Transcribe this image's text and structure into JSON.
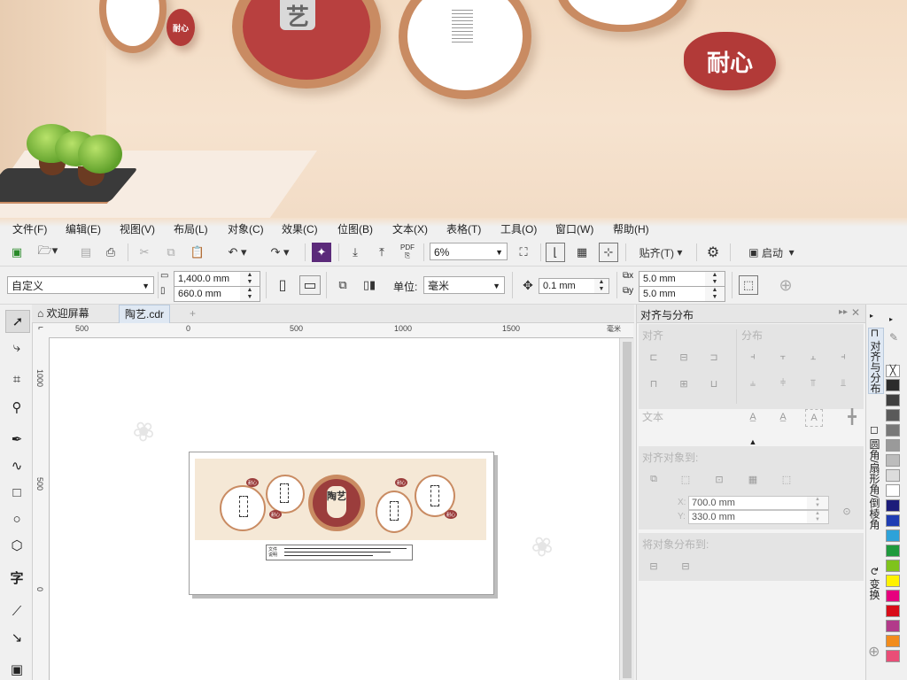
{
  "photo": {
    "badge_large": "耐心",
    "badge_small": "耐心",
    "vase_char": "艺"
  },
  "menu": {
    "items": [
      "文件(F)",
      "编辑(E)",
      "视图(V)",
      "布局(L)",
      "对象(C)",
      "效果(C)",
      "位图(B)",
      "文本(X)",
      "表格(T)",
      "工具(O)",
      "窗口(W)",
      "帮助(H)"
    ]
  },
  "toolbar1": {
    "pdf_label": "PDF",
    "zoom": "6%",
    "snap_label": "贴齐(T)",
    "launch_label": "启动"
  },
  "toolbar2": {
    "preset": "自定义",
    "width": "1,400.0 mm",
    "height": "660.0 mm",
    "unit_label": "单位:",
    "unit": "毫米",
    "nudge": "0.1 mm",
    "dup_x": "5.0 mm",
    "dup_y": "5.0 mm"
  },
  "doctabs": {
    "welcome": "欢迎屏幕",
    "file": "陶艺.cdr",
    "add": "+"
  },
  "ruler": {
    "top_ticks": [
      "500",
      "0",
      "500",
      "1000",
      "1500"
    ],
    "unit": "毫米",
    "left_ticks": [
      "1000",
      "500",
      "0"
    ]
  },
  "design": {
    "vase_text": "陶艺",
    "badge_text": "耐心",
    "legend_text": "文件说明"
  },
  "docker": {
    "title": "对齐与分布",
    "align_label": "对齐",
    "distribute_label": "分布",
    "text_label": "文本",
    "align_to_label": "对齐对象到:",
    "x_value": "700.0 mm",
    "y_value": "330.0 mm",
    "x_label": "X:",
    "y_label": "Y:",
    "distribute_to_label": "将对象分布到:"
  },
  "vtabs": {
    "tab1": "对齐与分布",
    "tab2": "圆角/扇形角/倒棱角",
    "tab3": "变换"
  },
  "palette": {
    "colors": [
      "#2b2b2b",
      "#404040",
      "#5a5a5a",
      "#787878",
      "#9a9a9a",
      "#bcbcbc",
      "#dcdcdc",
      "#ffffff",
      "#1c1c7a",
      "#1f3db3",
      "#2ea2d9",
      "#1f9a3d",
      "#7fc31c",
      "#fff200",
      "#e6007e",
      "#d80c18",
      "#b23a8a",
      "#f28c1c",
      "#e94e77"
    ]
  }
}
